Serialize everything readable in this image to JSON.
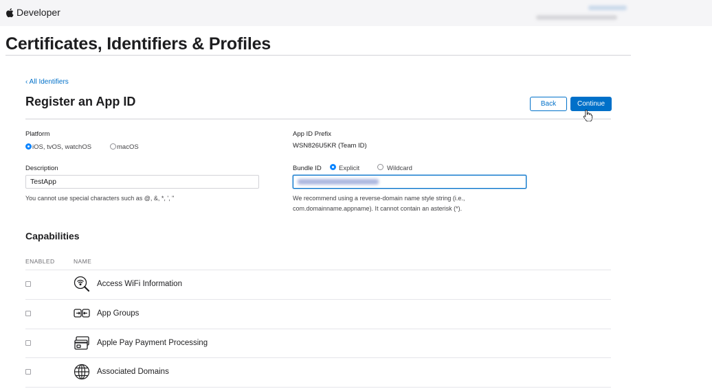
{
  "header": {
    "brand": "Developer"
  },
  "page": {
    "title": "Certificates, Identifiers & Profiles"
  },
  "breadcrumb": {
    "label": "‹ All Identifiers"
  },
  "form": {
    "title": "Register an App ID",
    "back_label": "Back",
    "continue_label": "Continue",
    "platform": {
      "label": "Platform",
      "options": [
        "iOS, tvOS, watchOS",
        "macOS"
      ],
      "selected": "iOS, tvOS, watchOS"
    },
    "app_id_prefix": {
      "label": "App ID Prefix",
      "value": "WSN826U5KR (Team ID)"
    },
    "description": {
      "label": "Description",
      "value": "TestApp",
      "help": "You cannot use special characters such as @, &, *, ', \""
    },
    "bundle_id": {
      "label": "Bundle ID",
      "options": [
        "Explicit",
        "Wildcard"
      ],
      "selected": "Explicit",
      "help_line1": "We recommend using a reverse-domain name style string (i.e.,",
      "help_line2": "com.domainname.appname). It cannot contain an asterisk (*)."
    }
  },
  "capabilities": {
    "title": "Capabilities",
    "columns": [
      "ENABLED",
      "NAME"
    ],
    "items": [
      {
        "name": "Access WiFi Information",
        "icon": "wifi-search-icon",
        "enabled": false
      },
      {
        "name": "App Groups",
        "icon": "app-groups-icon",
        "enabled": false
      },
      {
        "name": "Apple Pay Payment Processing",
        "icon": "credit-card-icon",
        "enabled": false
      },
      {
        "name": "Associated Domains",
        "icon": "globe-icon",
        "enabled": false
      }
    ]
  },
  "colors": {
    "accent": "#0070c9",
    "radio": "#0a84ff",
    "text": "#1d1d1f",
    "rule": "#d2d2d7"
  }
}
